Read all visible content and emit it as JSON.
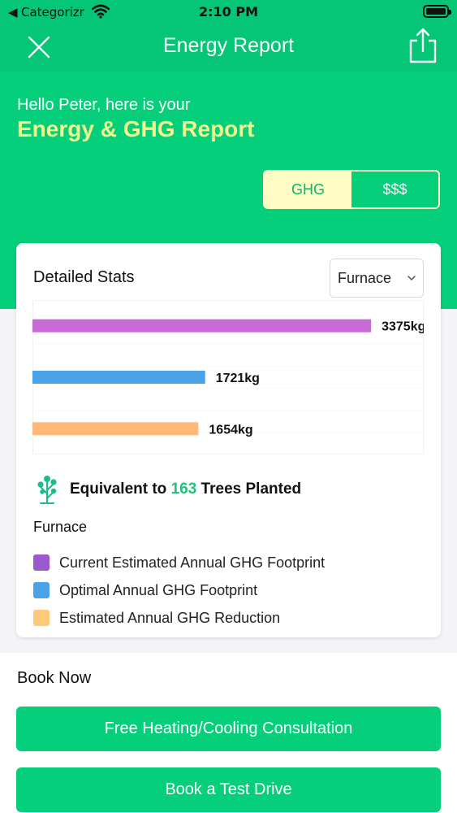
{
  "status_bar": {
    "back_glyph": "◀",
    "carrier": "Categorizr",
    "time": "2:10 PM"
  },
  "nav": {
    "title": "Energy Report",
    "close_icon": "close-icon",
    "share_icon": "share-icon"
  },
  "greeting": "Hello Peter, here is your",
  "headline": "Energy & GHG Report",
  "toggle": {
    "options": [
      "GHG",
      "$$$"
    ],
    "selected": "GHG"
  },
  "stats": {
    "title": "Detailed Stats",
    "dropdown_value": "Furnace",
    "equivalent_prefix": "Equivalent to ",
    "equivalent_number": "163",
    "equivalent_suffix": " Trees Planted",
    "legend_title": "Furnace",
    "legend": [
      {
        "label": "Current Estimated Annual GHG Footprint",
        "color": "#9b59d0"
      },
      {
        "label": "Optimal Annual GHG Footprint",
        "color": "#4aa3e8"
      },
      {
        "label": "Estimated Annual GHG Reduction",
        "color": "#ffc97a"
      }
    ]
  },
  "chart_data": {
    "type": "bar",
    "orientation": "horizontal",
    "categories": [
      "Current Estimated Annual GHG Footprint",
      "Optimal Annual GHG Footprint",
      "Estimated Annual GHG Reduction"
    ],
    "values": [
      3375,
      1721,
      1654
    ],
    "labels": [
      "3375kg",
      "1721kg",
      "1654kg"
    ],
    "colors": [
      "#c86bd6",
      "#4aa3e8",
      "#ffb878"
    ],
    "xlim": [
      0,
      3900
    ],
    "grid": true,
    "title": "",
    "xlabel": "",
    "ylabel": ""
  },
  "booking": {
    "title": "Book Now",
    "buttons": [
      "Free Heating/Cooling Consultation",
      "Book a Test Drive"
    ]
  },
  "colors": {
    "brand_green": "#06cf7c",
    "headline_yellow": "#f2f58a",
    "toggle_active_bg": "#fffbc4",
    "tree_number": "#22c07a"
  }
}
